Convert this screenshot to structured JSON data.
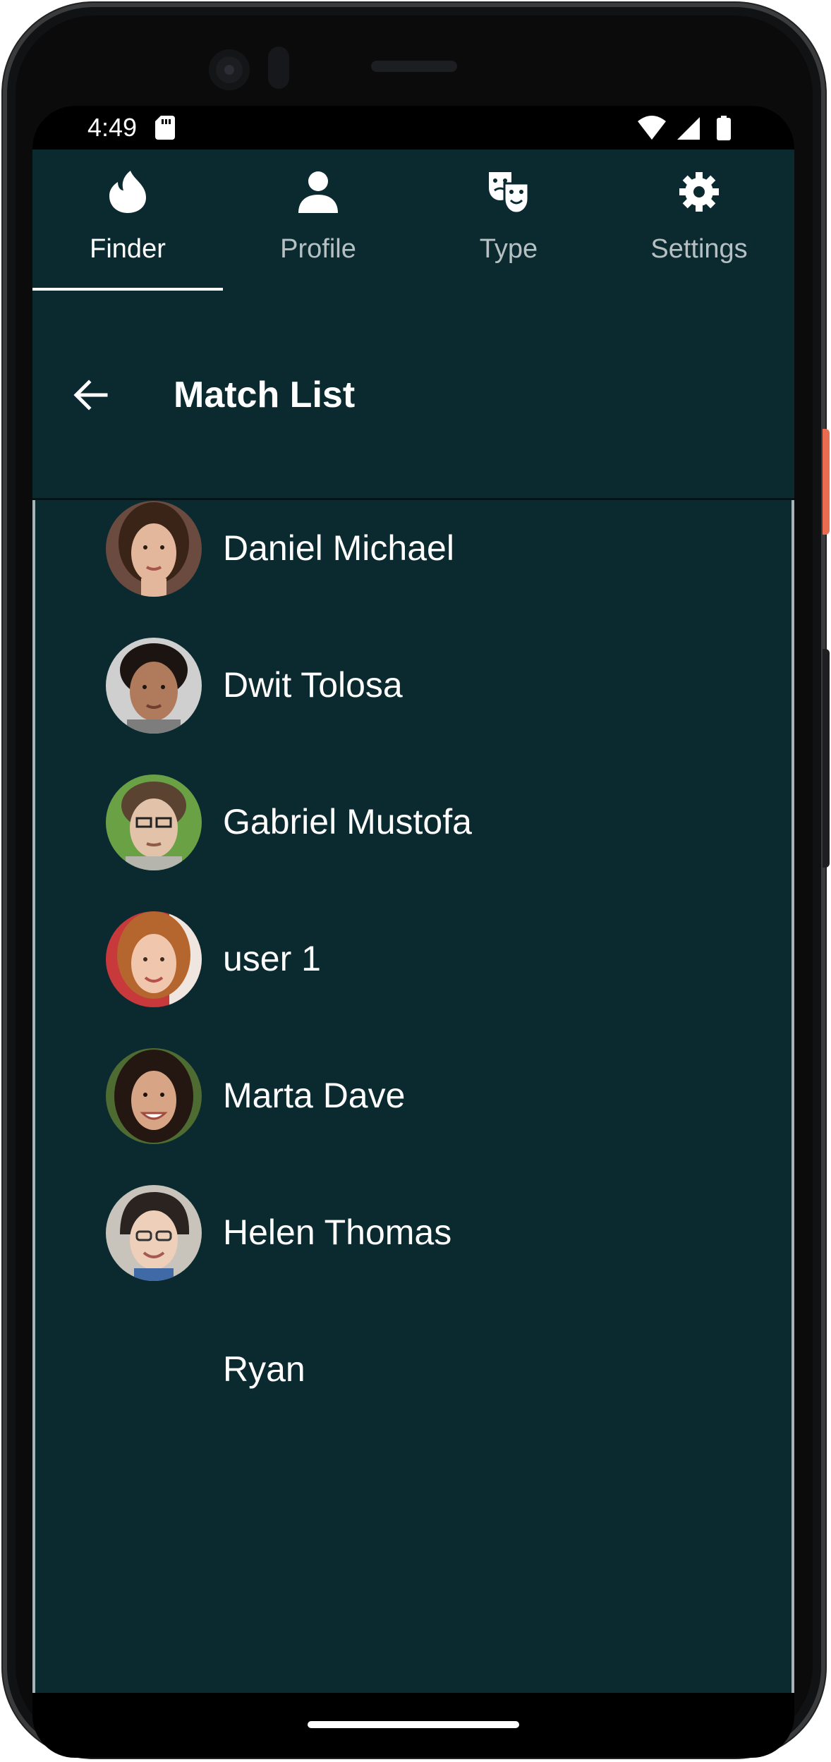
{
  "status_bar": {
    "time": "4:49",
    "icons": [
      "sd-card-icon",
      "wifi-icon",
      "signal-icon",
      "battery-icon"
    ]
  },
  "tabs": [
    {
      "label": "Finder",
      "icon": "flame-icon",
      "active": true
    },
    {
      "label": "Profile",
      "icon": "person-icon",
      "active": false
    },
    {
      "label": "Type",
      "icon": "theater-masks-icon",
      "active": false
    },
    {
      "label": "Settings",
      "icon": "gear-icon",
      "active": false
    }
  ],
  "app_bar": {
    "title": "Match List",
    "back_icon": "arrow-back-icon"
  },
  "matches": [
    {
      "name": "Daniel Michael",
      "avatar": "avatar-photo",
      "skin": "#e3b79c",
      "hair": "#3a2418",
      "bg": "#6b4a3f"
    },
    {
      "name": "Dwit Tolosa",
      "avatar": "avatar-photo",
      "skin": "#b07a5c",
      "hair": "#1c1410",
      "bg": "#cfcfcf"
    },
    {
      "name": "Gabriel Mustofa",
      "avatar": "avatar-photo",
      "skin": "#e2c2a8",
      "hair": "#5a4330",
      "bg": "#6aa145"
    },
    {
      "name": "user 1",
      "avatar": "avatar-photo",
      "skin": "#f0c7ad",
      "hair": "#b5652e",
      "bg": "#c8393c"
    },
    {
      "name": "Marta Dave",
      "avatar": "avatar-photo",
      "skin": "#d7a585",
      "hair": "#241611",
      "bg": "#4e6b32"
    },
    {
      "name": "Helen Thomas",
      "avatar": "avatar-photo",
      "skin": "#edcfba",
      "hair": "#2a2320",
      "bg": "#c9c4bb"
    },
    {
      "name": "Ryan",
      "avatar": "",
      "skin": "",
      "hair": "",
      "bg": ""
    }
  ],
  "colors": {
    "background": "#0b2a30",
    "text": "#ffffff",
    "inactive_text": "#b6c0c2",
    "indicator": "#ffffff"
  }
}
